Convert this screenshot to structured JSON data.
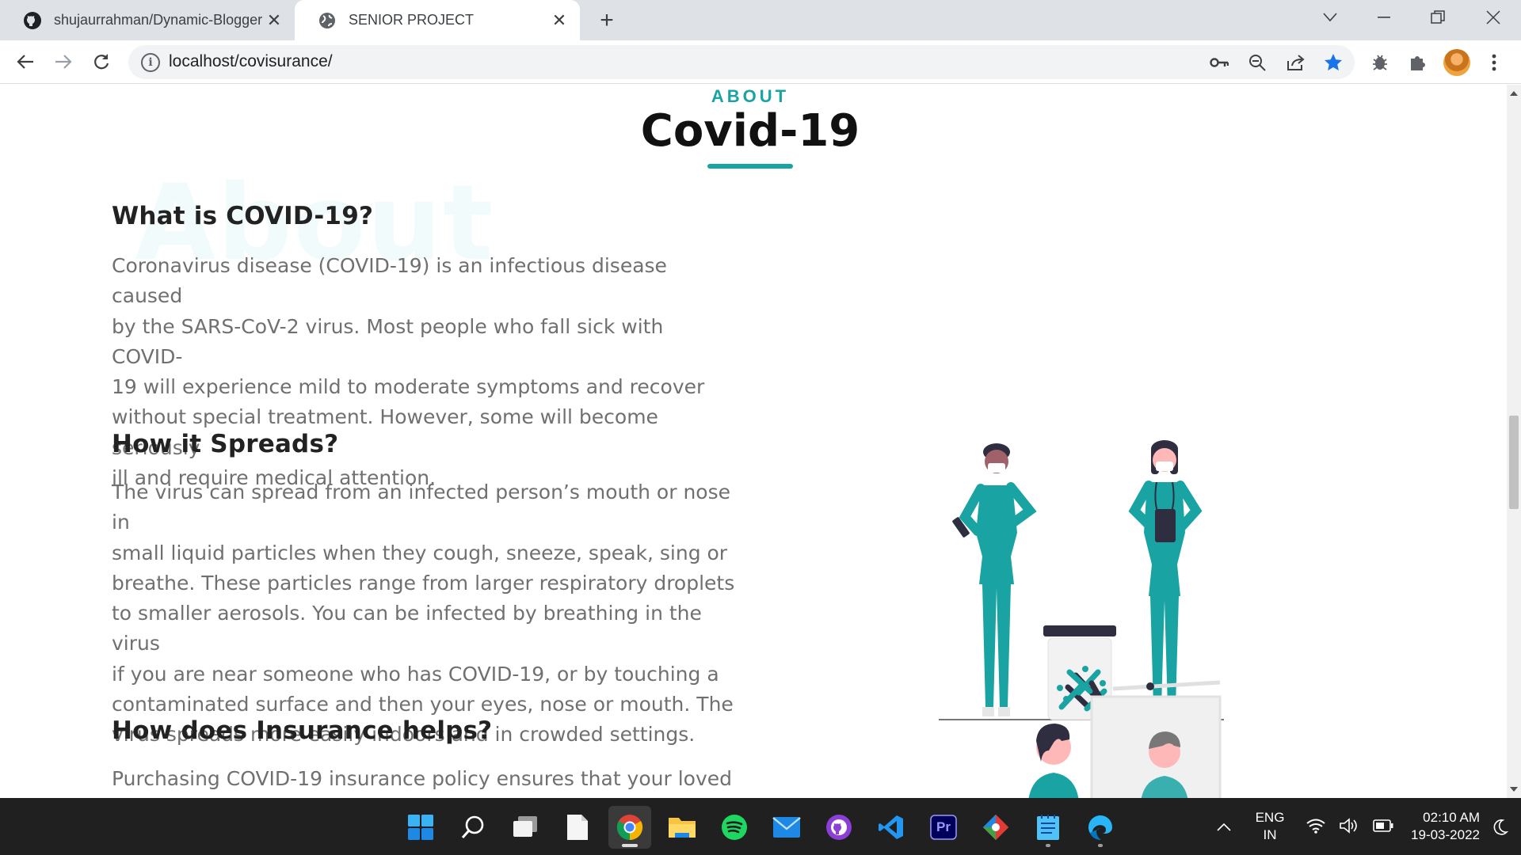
{
  "browser": {
    "tabs": [
      {
        "title": "shujaurrahman/Dynamic-Blogger",
        "icon": "github-icon",
        "active": false
      },
      {
        "title": "SENIOR PROJECT",
        "icon": "globe-icon",
        "active": true
      }
    ],
    "url": "localhost/covisurance/"
  },
  "page": {
    "eyebrow": "ABOUT",
    "title": "Covid-19",
    "ghost_text": "About",
    "accent_color": "#1aa3a3",
    "sections": [
      {
        "heading": "What is COVID-19?",
        "lines": [
          "Coronavirus disease (COVID-19) is an infectious disease caused",
          "by the SARS-CoV-2 virus. Most people who fall sick with COVID-",
          "19 will experience mild to moderate symptoms and recover",
          "without special treatment. However, some will become seriously",
          "ill and require medical attention."
        ]
      },
      {
        "heading": "How it Spreads?",
        "lines": [
          "The virus can spread from an infected person’s mouth or nose in",
          "small liquid particles when they cough, sneeze, speak, sing or",
          "breathe. These particles range from larger respiratory droplets",
          "to smaller aerosols. You can be infected by breathing in the virus",
          "if you are near someone who has COVID-19, or by touching a",
          "contaminated surface and then your eyes, nose or mouth. The",
          "virus spreads more easily indoors and in crowded settings."
        ]
      },
      {
        "heading": "How does Insurance helps?",
        "lines": [
          "Purchasing COVID-19 insurance policy ensures that your loved"
        ]
      }
    ]
  },
  "taskbar": {
    "apps": [
      "windows-start-icon",
      "search-icon",
      "task-view-icon",
      "file-icon",
      "chrome-icon",
      "file-explorer-icon",
      "spotify-icon",
      "mail-icon",
      "github-desktop-icon",
      "vscode-icon",
      "premiere-pro-icon",
      "git-icon",
      "notepad-icon",
      "edge-dev-icon"
    ],
    "premiere_label": "Pr",
    "language": "ENG",
    "region": "IN",
    "time": "02:10 AM",
    "date": "19-03-2022"
  }
}
